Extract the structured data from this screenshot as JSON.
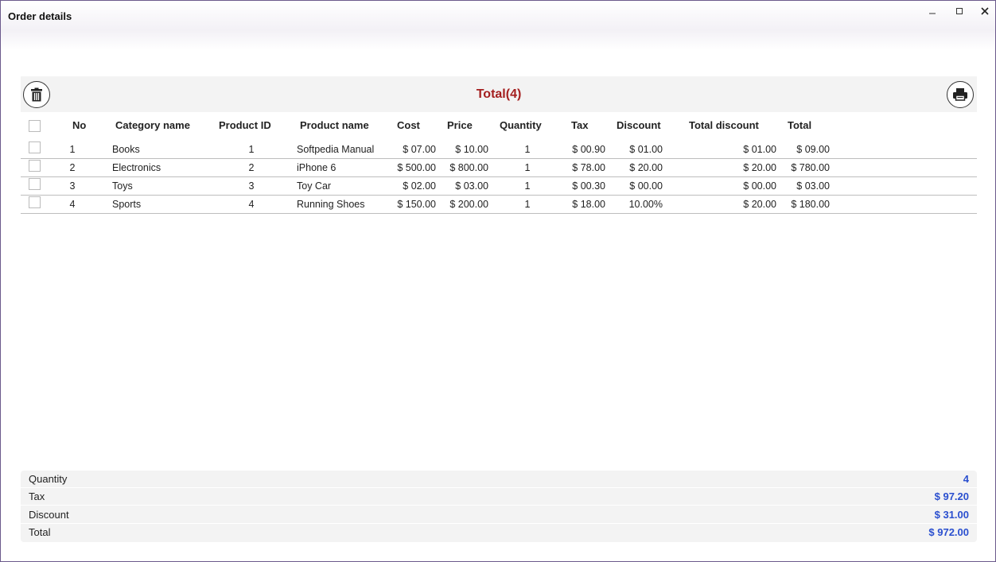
{
  "window": {
    "title": "Order details",
    "minimize_icon": "minimize-icon",
    "maximize_icon": "maximize-icon",
    "close_icon": "close-icon"
  },
  "toolbar": {
    "title": "Total(4)",
    "delete_icon": "trash-icon",
    "print_icon": "printer-icon"
  },
  "colors": {
    "toolbar_title": "#a41f1f",
    "summary_value": "#2a4fcf",
    "window_border": "#6b5a8c"
  },
  "table": {
    "columns": [
      "No",
      "Category name",
      "Product ID",
      "Product name",
      "Cost",
      "Price",
      "Quantity",
      "Tax",
      "Discount",
      "Total discount",
      "Total"
    ],
    "rows": [
      [
        "1",
        "Books",
        "1",
        "Softpedia Manual",
        "$ 07.00",
        "$ 10.00",
        "1",
        "$ 00.90",
        "$ 01.00",
        "$ 01.00",
        "$ 09.00"
      ],
      [
        "2",
        "Electronics",
        "2",
        "iPhone 6",
        "$ 500.00",
        "$ 800.00",
        "1",
        "$ 78.00",
        "$ 20.00",
        "$ 20.00",
        "$ 780.00"
      ],
      [
        "3",
        "Toys",
        "3",
        "Toy Car",
        "$ 02.00",
        "$ 03.00",
        "1",
        "$ 00.30",
        "$ 00.00",
        "$ 00.00",
        "$ 03.00"
      ],
      [
        "4",
        "Sports",
        "4",
        "Running Shoes",
        "$ 150.00",
        "$ 200.00",
        "1",
        "$ 18.00",
        "10.00%",
        "$ 20.00",
        "$ 180.00"
      ]
    ]
  },
  "summary": {
    "quantity_label": "Quantity",
    "quantity_value": "4",
    "tax_label": "Tax",
    "tax_value": "$ 97.20",
    "discount_label": "Discount",
    "discount_value": "$ 31.00",
    "total_label": "Total",
    "total_value": "$ 972.00"
  }
}
